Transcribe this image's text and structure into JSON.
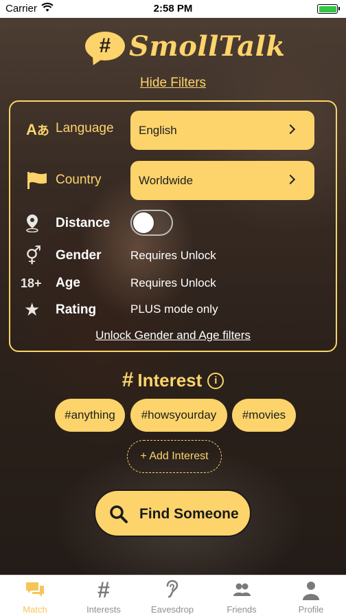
{
  "status_bar": {
    "carrier": "Carrier",
    "time": "2:58 PM"
  },
  "app": {
    "logo_symbol": "#",
    "name": "SmollTalk"
  },
  "filters": {
    "toggle_label": "Hide Filters",
    "language": {
      "label": "Language",
      "icon": "translate-icon",
      "value": "English"
    },
    "country": {
      "label": "Country",
      "icon": "flag-icon",
      "value": "Worldwide"
    },
    "distance": {
      "label": "Distance",
      "icon": "location-pin-icon",
      "enabled": false
    },
    "gender": {
      "label": "Gender",
      "icon": "gender-icon",
      "value": "Requires Unlock"
    },
    "age": {
      "label": "Age",
      "icon_text": "18+",
      "value": "Requires Unlock"
    },
    "rating": {
      "label": "Rating",
      "icon": "star-icon",
      "value": "PLUS mode only"
    },
    "unlock_link": "Unlock Gender and Age filters"
  },
  "interest": {
    "symbol": "#",
    "title": "Interest",
    "info_symbol": "i",
    "tags": [
      "#anything",
      "#howsyourday",
      "#movies"
    ],
    "add_label": "+ Add Interest"
  },
  "find_button": {
    "label": "Find Someone",
    "icon": "search-icon"
  },
  "tabs": [
    {
      "label": "Match",
      "icon": "chat-bubbles-icon",
      "active": true
    },
    {
      "label": "Interests",
      "icon": "hash-icon",
      "active": false
    },
    {
      "label": "Eavesdrop",
      "icon": "ear-icon",
      "active": false
    },
    {
      "label": "Friends",
      "icon": "people-icon",
      "active": false
    },
    {
      "label": "Profile",
      "icon": "person-icon",
      "active": false
    }
  ],
  "colors": {
    "accent": "#fcd46b",
    "tab_active": "#f6c55a",
    "tab_inactive": "#8e8e8e"
  }
}
